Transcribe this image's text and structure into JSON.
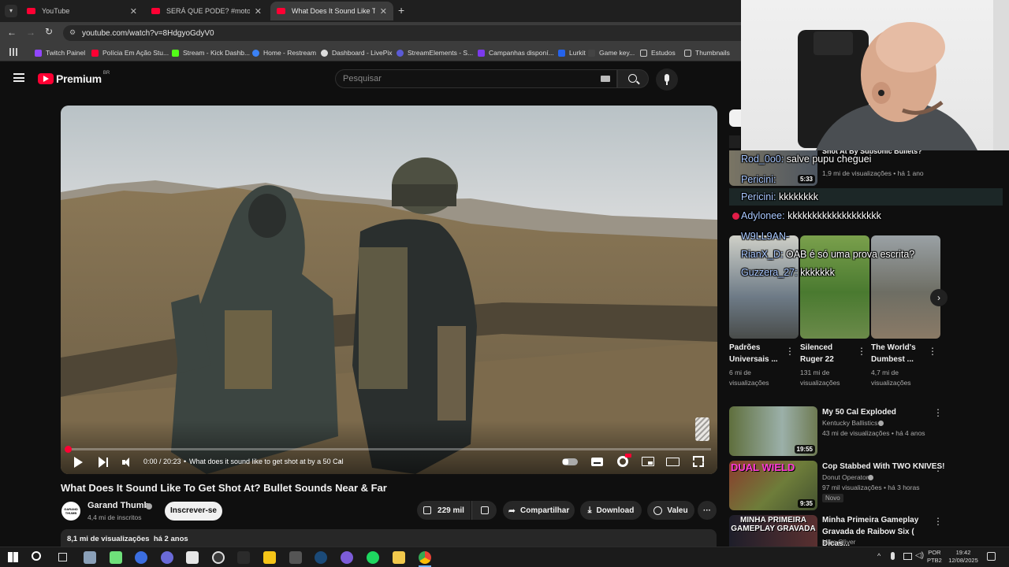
{
  "browser": {
    "tabs": [
      {
        "title": "YouTube"
      },
      {
        "title": "SERÁ QUE PODE? #moto #moto"
      },
      {
        "title": "What Does It Sound Like To Ge"
      }
    ],
    "url": "youtube.com/watch?v=8HdgyoGdyV0",
    "bookmarks": [
      "Twitch Painel",
      "Polícia Em Ação Stu...",
      "Stream - Kick Dashb...",
      "Home - Restream",
      "Dashboard - LivePix",
      "StreamElements - S...",
      "Campanhas disponí...",
      "Lurkit",
      "Game key...",
      "Estudos",
      "Thumbnails"
    ]
  },
  "yt": {
    "logo_text": "Premium",
    "logo_region": "BR",
    "search_placeholder": "Pesquisar"
  },
  "player": {
    "time": "0:00 / 20:23",
    "chapter": "What does it sound like to get shot at by a 50 Cal",
    "progress": 0.0
  },
  "video": {
    "title": "What Does It Sound Like To Get Shot At? Bullet Sounds Near & Far",
    "channel": "Garand Thumb",
    "subscribers": "4,4 mi de inscritos",
    "subscribe_label": "Inscrever-se",
    "likes": "229 mil",
    "share_label": "Compartilhar",
    "download_label": "Download",
    "thanks_label": "Valeu",
    "views_line": "8,1 mi de visualizações  há 2 anos",
    "channel_avatar_text": "GARAND THUMB"
  },
  "sidebar": {
    "top_partial": {
      "title": "Shot At By Subsonic Bullets?",
      "meta": "1,9 mi de visualizações • há 1 ano",
      "duration": "5:33"
    },
    "shorts": [
      {
        "title": "Padrões Universais ...",
        "meta1": "6 mi de",
        "meta2": "visualizações"
      },
      {
        "title": "Silenced Ruger 22",
        "meta1": "131 mi de",
        "meta2": "visualizações"
      },
      {
        "title": "The World's Dumbest ...",
        "meta1": "4,7 mi de",
        "meta2": "visualizações"
      }
    ],
    "videos": [
      {
        "title": "My 50 Cal Exploded",
        "channel": "Kentucky Ballistics",
        "meta": "43 mi de visualizações • há 4 anos",
        "duration": "19:55",
        "badge": ""
      },
      {
        "title": "Cop Stabbed With TWO KNIVES!",
        "channel": "Donut Operator",
        "meta": "97 mil visualizações • há 3 horas",
        "duration": "9:35",
        "badge": "Novo",
        "thumb_text": "DUAL WIELD"
      },
      {
        "title": "Minha Primeira Gameplay Gravada de Raibow Six ( Dicas...",
        "channel": "Mike Oliver",
        "meta": "",
        "duration": "",
        "badge": "",
        "thumb_text": "MINHA PRIMEIRA GAMEPLAY GRAVADA"
      }
    ]
  },
  "chat": [
    {
      "nick": "Rod_0o0:",
      "msg": "salve pupu cheguei"
    },
    {
      "nick": "Pericini:",
      "msg": ""
    },
    {
      "nick": "Pericini:",
      "msg": "kkkkkkkk"
    },
    {
      "nick": "Adylonee:",
      "msg": "kkkkkkkkkkkkkkkkkkk"
    },
    {
      "nick": "W9LL9AN-",
      "msg": ""
    },
    {
      "nick": "RianX_D:",
      "msg": "OAB é só uma prova escrita?"
    },
    {
      "nick": "Guzzera_27:",
      "msg": "kkkkkkk"
    }
  ],
  "taskbar": {
    "lang1": "POR",
    "lang2": "PTB2",
    "time": "19:42",
    "date": "12/08/2025"
  },
  "colors": {
    "yt_red": "#ff0033",
    "bg": "#0f0f0f",
    "chat_nick": "#a9c8ff"
  }
}
